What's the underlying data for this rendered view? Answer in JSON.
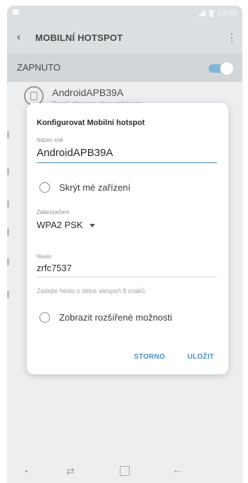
{
  "status_bar": {
    "time": "10:00"
  },
  "app_bar": {
    "title": "MOBILNÍ HOTSPOT"
  },
  "switch_row": {
    "label": "ZAPNUTO",
    "state": "on"
  },
  "network": {
    "name": "AndroidAPB39A",
    "subtitle": "Povolí připojení všem zařízením"
  },
  "dialog": {
    "title": "Konfigurovat Mobilní hotspot",
    "ssid_label": "Název sítě",
    "ssid_value": "AndroidAPB39A",
    "hide_device_label": "Skrýt mé zařízení",
    "security_label": "Zabezpečení",
    "security_value": "WPA2 PSK",
    "password_label": "Heslo",
    "password_value": "zrfc7537",
    "password_hint": "Zadejte heslo o délce alespoň 8 znaků.",
    "advanced_label": "Zobrazit rozšířené možnosti",
    "cancel_label": "STORNO",
    "save_label": "ULOŽIT"
  },
  "colors": {
    "accent": "#4c8fc1",
    "dim_background": "#dcdfe1"
  }
}
